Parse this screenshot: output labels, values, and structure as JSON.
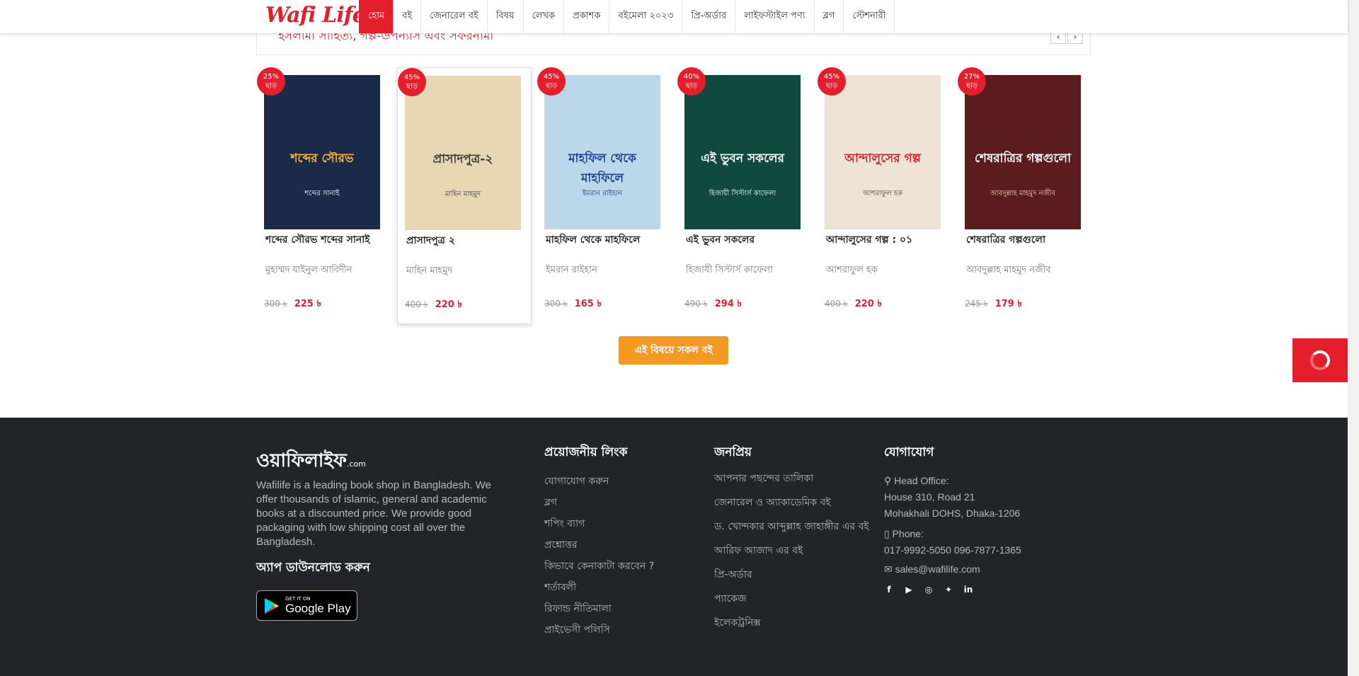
{
  "brand": {
    "logo_text": "Wafi Life",
    "accent": "#e41e2b"
  },
  "nav": {
    "items": [
      "হোম",
      "বই",
      "জেনারেল বই",
      "বিষয়",
      "লেখক",
      "প্রকাশক",
      "বইমেলা ২০২৩",
      "প্রি-অর্ডার",
      "লাইফস্টাইল পণ্য",
      "ব্লগ",
      "স্টেশনারী"
    ],
    "active_index": 0
  },
  "section": {
    "title": "ইসলামী সাহিত্য, গল্প-উপন্যাস এবং সফরনামা",
    "prev_icon": "‹",
    "next_icon": "›"
  },
  "books": [
    {
      "discount": "25%",
      "discount_word": "ছাড়",
      "title": "শব্দের সৌরভ শব্দের সানাই",
      "author": "মুহাম্মদ যাইনুল আবিদীন",
      "old_price": "300 ৳",
      "new_price": "225 ৳",
      "cover_title": "শব্দের সৌরভ",
      "cover_subtitle": "শব্দের সানাই",
      "cover_color": "#1c2a49"
    },
    {
      "discount": "45%",
      "discount_word": "ছাড়",
      "title": "প্রাসাদপুত্র ২",
      "author": "মাহিন মাহমুদ",
      "old_price": "400 ৳",
      "new_price": "220 ৳",
      "cover_title": "প্রাসাদপুত্র-২",
      "cover_subtitle": "মাহিন মাহমুদ",
      "cover_color": "#e9d6b2"
    },
    {
      "discount": "45%",
      "discount_word": "ছাড়",
      "title": "মাহফিল থেকে মাহফিলে",
      "author": "ইমরান রাইহান",
      "old_price": "300 ৳",
      "new_price": "165 ৳",
      "cover_title": "মাহফিল থেকে মাহফিলে",
      "cover_subtitle": "ইমরান রাইহান",
      "cover_color": "#bcd6ea"
    },
    {
      "discount": "40%",
      "discount_word": "ছাড়",
      "title": "এই ভুবন সকলের",
      "author": "হিজাযী সিস্টার্স কাফেলা",
      "old_price": "490 ৳",
      "new_price": "294 ৳",
      "cover_title": "এই ভুবন সকলের",
      "cover_subtitle": "হিজাযী সিস্টার্স কাফেলা",
      "cover_color": "#0f4a3c"
    },
    {
      "discount": "45%",
      "discount_word": "ছাড়",
      "title": "আন্দালুসের গল্প : ০১",
      "author": "আশরাফুল হক",
      "old_price": "400 ৳",
      "new_price": "220 ৳",
      "cover_title": "আন্দালুসের গল্প",
      "cover_subtitle": "আশরাফুল হক",
      "cover_color": "#efe3d6"
    },
    {
      "discount": "27%",
      "discount_word": "ছাড়",
      "title": "শেষরাত্রির গল্পগুলো",
      "author": "আবদুল্লাহ মাহমুদ নজীব",
      "old_price": "245 ৳",
      "new_price": "179 ৳",
      "cover_title": "শেষরাত্রির গল্পগুলো",
      "cover_subtitle": "আবদুল্লাহ মাহমুদ নজীব",
      "cover_color": "#5a1c1d"
    }
  ],
  "hovered_book_index": 1,
  "all_books_button": "এই বিষয়ে সকল বই",
  "footer": {
    "logo": "ওয়াফিলাইফ",
    "logo_suffix": ".com",
    "about": "Wafilife is a leading book shop in Bangladesh. We offer thousands of islamic, general and academic books at a discounted price. We provide good packaging with low shipping cost all over the Bangladesh.",
    "app_heading": "অ্যাপ ডাউনলোড করুন",
    "google_play": {
      "small": "GET IT ON",
      "big": "Google Play"
    },
    "useful": {
      "heading": "প্রয়োজনীয় লিংক",
      "links": [
        "যোগাযোগ করুন",
        "ব্লগ",
        "শপিং ব্যাগ",
        "প্রশ্নোত্তর",
        "কিভাবে কেনাকাটা করবেন ?",
        "শর্তাবলী",
        "রিফান্ড নীতিমালা",
        "প্রাইভেসী পলিসি"
      ]
    },
    "popular": {
      "heading": "জনপ্রিয়",
      "links": [
        "আপনার পছন্দের তালিকা",
        "জেনারেল ও অ্যাকাডেমিক বই",
        "ড. খোন্দকার আব্দুল্লাহ জাহাঙ্গীর এর বই",
        "আরিফ আজাদ এর বই",
        "প্রি-অর্ডার",
        "প্যাকেজ",
        "ইলেকট্রনিক্স"
      ]
    },
    "contact": {
      "heading": "যোগাযোগ",
      "office_label": "Head Office:",
      "address1": "House 310, Road 21",
      "address2": "Mohakhali DOHS, Dhaka-1206",
      "phone_label": "Phone:",
      "phone": "017-9992-5050  096-7877-1365",
      "email": "sales@wafilife.com",
      "socials": [
        "facebook-icon",
        "youtube-icon",
        "instagram-icon",
        "twitter-icon",
        "linkedin-icon"
      ]
    }
  }
}
